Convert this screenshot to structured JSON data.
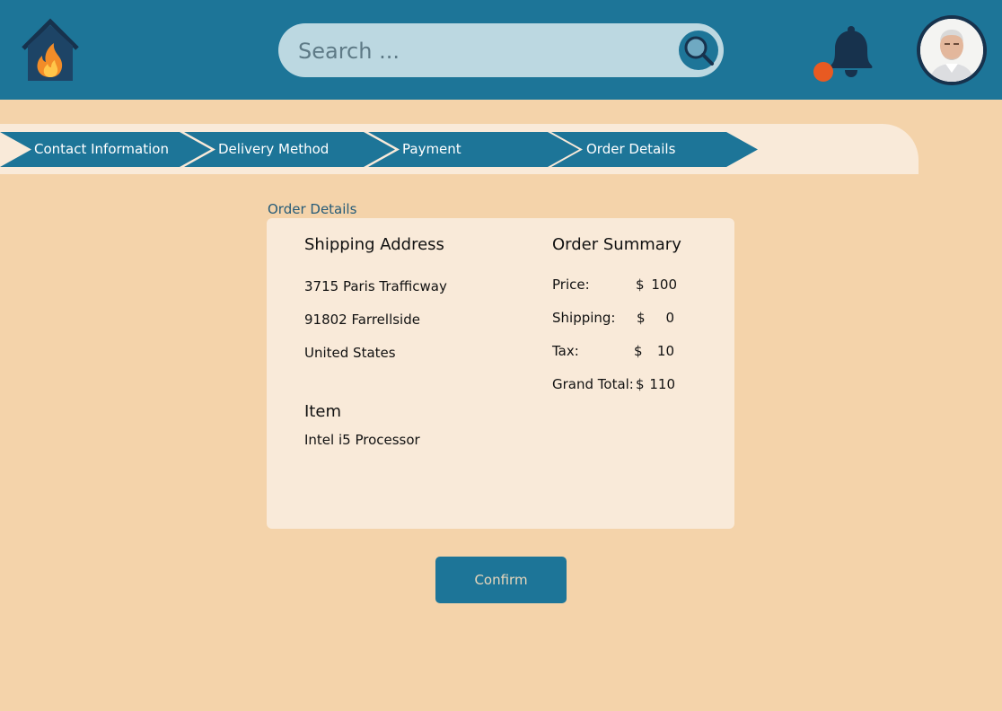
{
  "search": {
    "placeholder": "Search ..."
  },
  "notifications": {
    "has_unread": true
  },
  "steps": [
    {
      "label": "Contact Information"
    },
    {
      "label": "Delivery Method"
    },
    {
      "label": "Payment"
    },
    {
      "label": "Order Details"
    }
  ],
  "section_title": "Order Details",
  "shipping": {
    "heading": "Shipping Address",
    "street": "3715 Paris Trafficway",
    "postal_city": "91802 Farrellside",
    "country": "United States"
  },
  "item": {
    "heading": "Item",
    "name": "Intel i5 Processor"
  },
  "summary": {
    "heading": "Order Summary",
    "rows": [
      {
        "label": "Price:",
        "currency": "$",
        "value": "100"
      },
      {
        "label": "Shipping:",
        "currency": "$",
        "value": "0"
      },
      {
        "label": "Tax:",
        "currency": "$",
        "value": "10"
      },
      {
        "label": "Grand Total:",
        "currency": "$",
        "value": "110"
      }
    ]
  },
  "confirm_label": "Confirm",
  "colors": {
    "primary": "#1D7598",
    "background": "#F4D3AA",
    "card": "#F9EAD9",
    "search_bg": "#BCD8E1",
    "notification_dot": "#E85A22",
    "icon_dark": "#17324D"
  }
}
